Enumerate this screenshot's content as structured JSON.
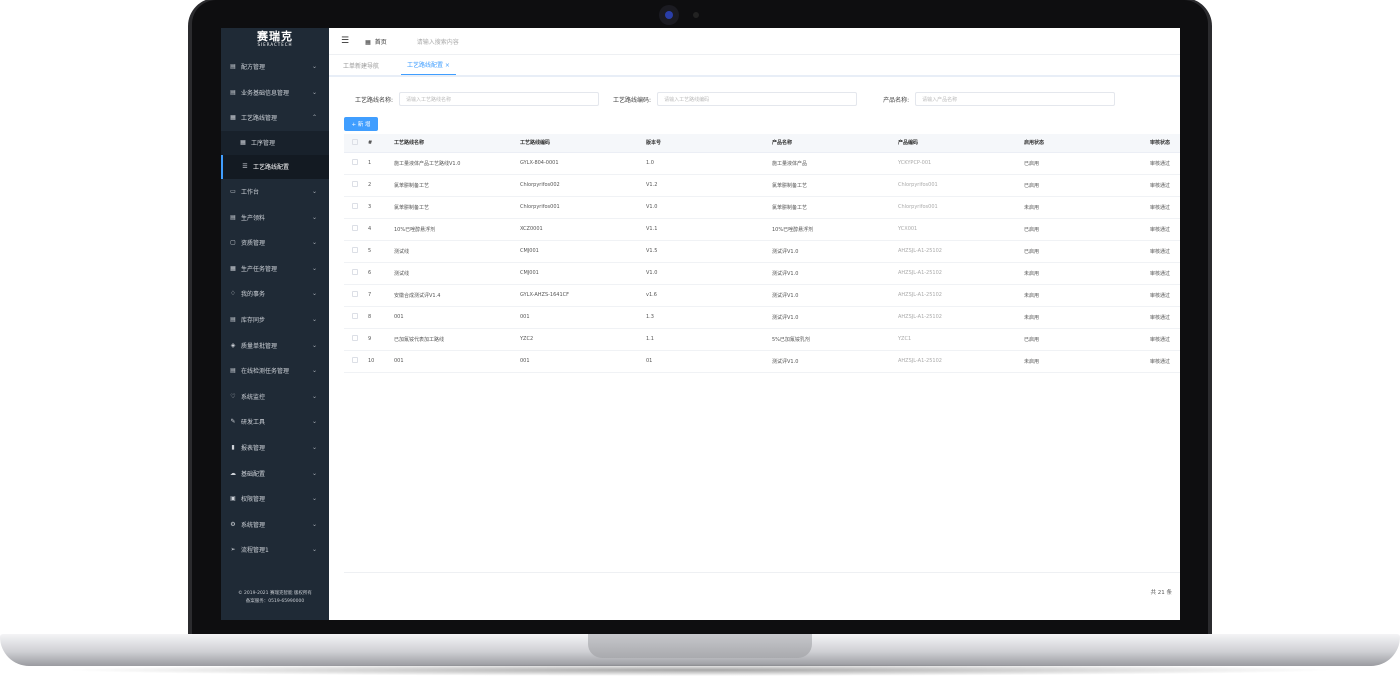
{
  "sidebar": {
    "logo_main": "赛瑞克",
    "logo_sub": "SIERACTECH",
    "items": [
      {
        "label": "配方管理",
        "icon": "doc"
      },
      {
        "label": "业务基础信息管理",
        "icon": "doc"
      },
      {
        "label": "工艺路线管理",
        "icon": "grid"
      },
      {
        "label": "工序管理",
        "icon": "grid"
      },
      {
        "label": "工艺路线配置",
        "icon": "list"
      },
      {
        "label": "工作台",
        "icon": "monitor"
      },
      {
        "label": "生产领料",
        "icon": "doc"
      },
      {
        "label": "资质管理",
        "icon": "box"
      },
      {
        "label": "生产任务管理",
        "icon": "grid"
      },
      {
        "label": "我的事务",
        "icon": "bell"
      },
      {
        "label": "库存同步",
        "icon": "doc"
      },
      {
        "label": "质量单批管理",
        "icon": "shield"
      },
      {
        "label": "在线检测任务管理",
        "icon": "doc"
      },
      {
        "label": "系统监控",
        "icon": "heart"
      },
      {
        "label": "研发工具",
        "icon": "tool"
      },
      {
        "label": "报表管理",
        "icon": "chart"
      },
      {
        "label": "基础配置",
        "icon": "cloud"
      },
      {
        "label": "权限管理",
        "icon": "lock"
      },
      {
        "label": "系统管理",
        "icon": "gear"
      },
      {
        "label": "流程管理1",
        "icon": "send"
      }
    ],
    "footer_line1": "© 2019-2021 赛瑞克智能 版权所有",
    "footer_line2": "备案服务：0519-65990000"
  },
  "topbar": {
    "home_label": "首页",
    "search_placeholder": "请输入搜索内容"
  },
  "tabs": [
    {
      "label": "工单新建导航"
    },
    {
      "label": "工艺路线配置  ×"
    }
  ],
  "filters": {
    "route_name_label": "工艺路线名称:",
    "route_name_placeholder": "请输入工艺路线名称",
    "route_code_label": "工艺路线编码:",
    "route_code_placeholder": "请输入工艺路线编码",
    "product_name_label": "产品名称:",
    "product_name_placeholder": "请输入产品名称"
  },
  "add_button": "+ 新 增",
  "table": {
    "headers": [
      "#",
      "工艺路线名称",
      "工艺路线编码",
      "版本号",
      "产品名称",
      "产品编码",
      "启用状态",
      "审核状态"
    ],
    "rows": [
      [
        "1",
        "施工量液体产品工艺路线V1.0",
        "GYLX-804-0001",
        "1.0",
        "施工量液体产品",
        "YCKYPCP-001",
        "已启用",
        "审核通过"
      ],
      [
        "2",
        "氯苯肼制备工艺",
        "Chlorpyrifos002",
        "V1.2",
        "氯苯肼制备工艺",
        "Chlorpyrifos001",
        "已启用",
        "审核通过"
      ],
      [
        "3",
        "氯苯肼制备工艺",
        "Chlorpyrifos001",
        "V1.0",
        "氯苯肼制备工艺",
        "Chlorpyrifos001",
        "未启用",
        "审核通过"
      ],
      [
        "4",
        "10%已唑醇悬浮剂",
        "XCZ0001",
        "V1.1",
        "10%已唑醇悬浮剂",
        "YCX001",
        "已启用",
        "审核通过"
      ],
      [
        "5",
        "测试线",
        "CMJ001",
        "V1.5",
        "测试评V1.0",
        "AHZSJL-A1-25102",
        "已启用",
        "审核通过"
      ],
      [
        "6",
        "测试线",
        "CMJ001",
        "V1.0",
        "测试评V1.0",
        "AHZSJL-A1-25102",
        "未启用",
        "审核通过"
      ],
      [
        "7",
        "安徽合成测试评V1.4",
        "GYLX-AHZS-1641CF",
        "v1.6",
        "测试评V1.0",
        "AHZSJL-A1-25102",
        "未启用",
        "审核通过"
      ],
      [
        "8",
        "001",
        "001",
        "1.3",
        "测试评V1.0",
        "AHZSJL-A1-25102",
        "未启用",
        "审核通过"
      ],
      [
        "9",
        "已加氟铵代表加工路线",
        "YZC2",
        "1.1",
        "5%已加氟铵乳剂",
        "YZC1",
        "已启用",
        "审核通过"
      ],
      [
        "10",
        "001",
        "001",
        "01",
        "测试评V1.0",
        "AHZSJL-A1-25102",
        "未启用",
        "审核通过"
      ]
    ]
  },
  "pagination": {
    "total_text": "共 21 条"
  }
}
